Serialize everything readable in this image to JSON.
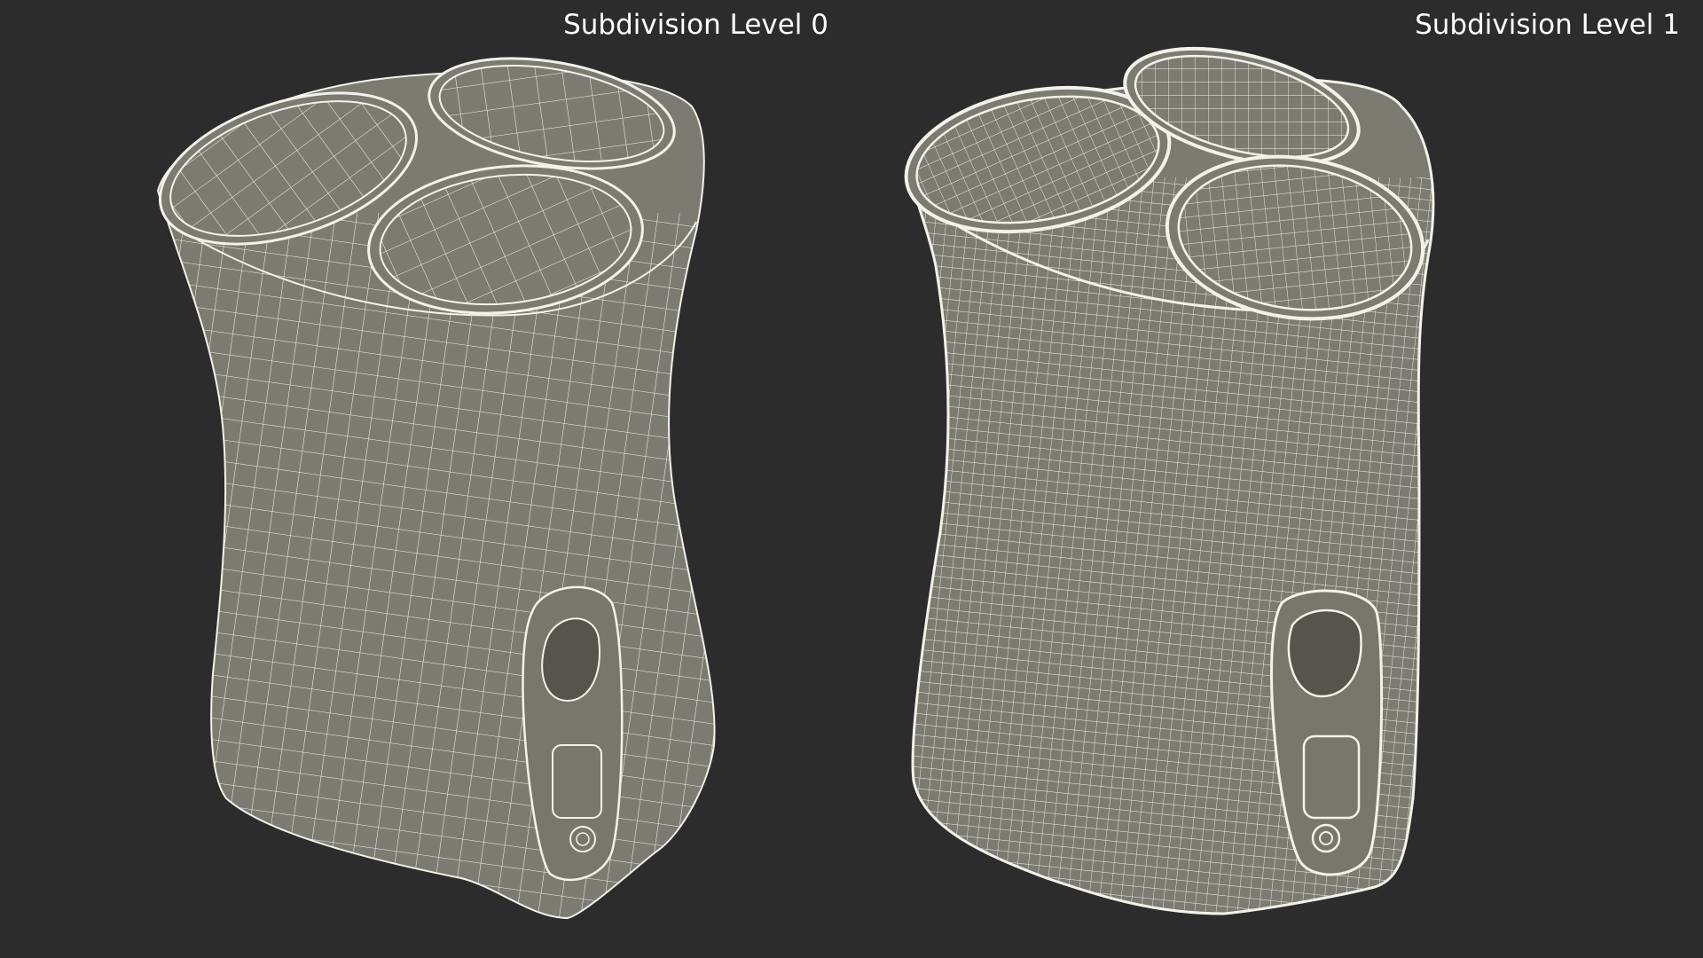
{
  "viewports": {
    "left": {
      "label": "Subdivision Level 0",
      "subdivision_level": 0
    },
    "right": {
      "label": "Subdivision Level 1",
      "subdivision_level": 1
    }
  },
  "colors": {
    "background": "#2c2c2c",
    "surface": "#7b7b72",
    "wire": "#f2f2ea",
    "label": "#ffffff"
  }
}
